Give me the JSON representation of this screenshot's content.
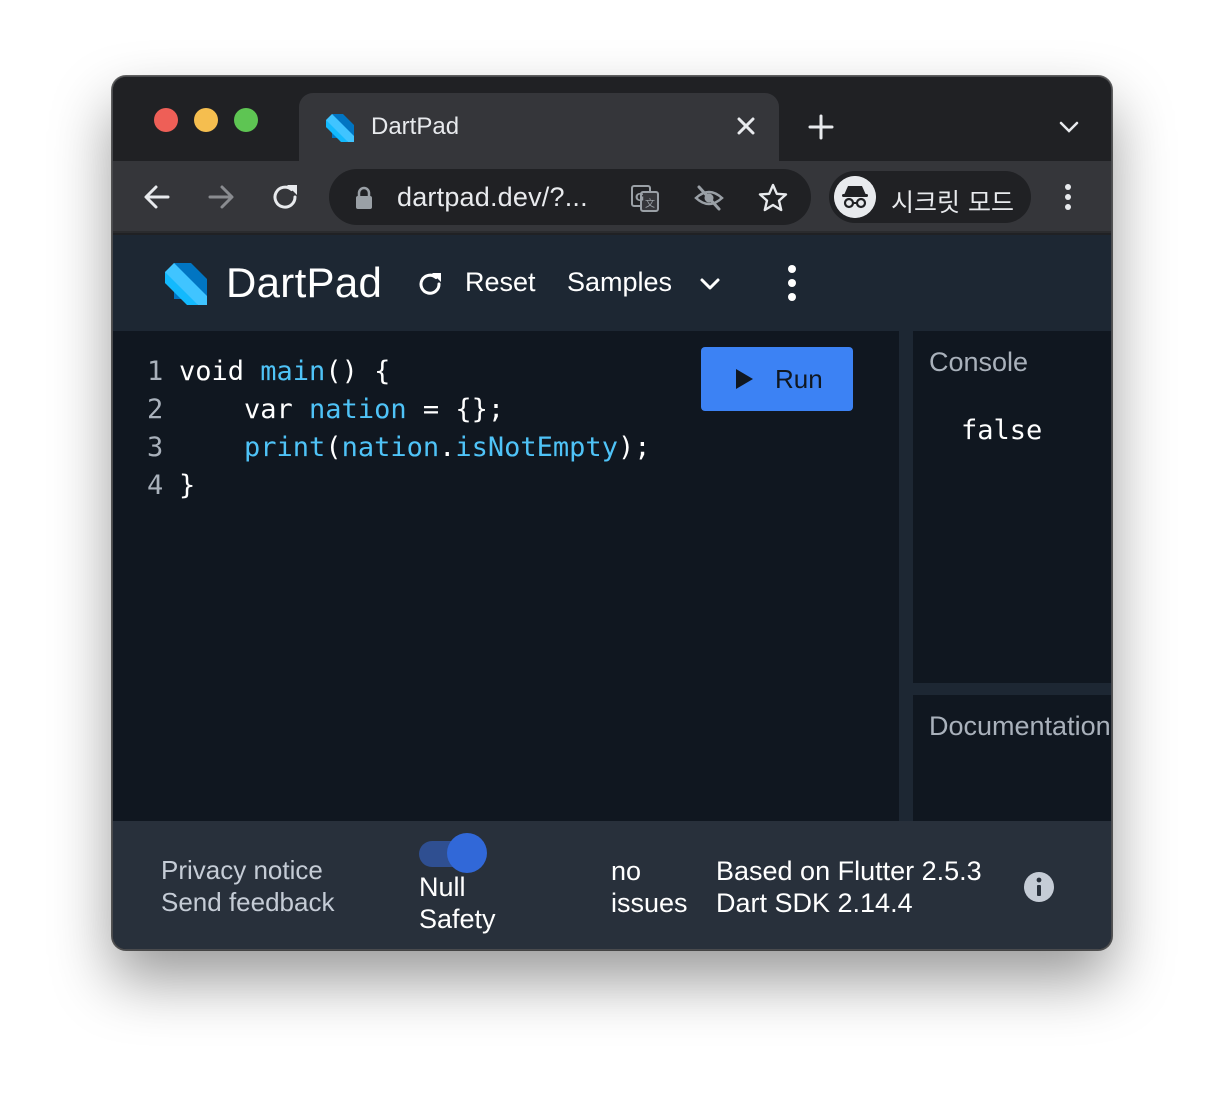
{
  "browser": {
    "tab": {
      "title": "DartPad",
      "favicon": "dart-logo-icon",
      "close_icon": "close-icon"
    },
    "new_tab_icon": "plus-icon",
    "tab_menu_icon": "chevron-down-icon",
    "nav": {
      "back_icon": "arrow-left-icon",
      "forward_icon": "arrow-right-icon",
      "reload_icon": "reload-icon"
    },
    "omnibox": {
      "url": "dartpad.dev/?...",
      "icons": [
        "lock-icon",
        "translate-icon",
        "eye-off-icon",
        "star-icon"
      ]
    },
    "incognito": {
      "label": "시크릿 모드",
      "icon": "incognito-icon"
    },
    "menu_icon": "kebab-icon"
  },
  "app": {
    "title": "DartPad",
    "logo": "dart-logo-icon",
    "reset_label": "Reset",
    "samples_label": "Samples",
    "menu_icon": "kebab-icon"
  },
  "editor": {
    "run_label": "Run",
    "lines": [
      {
        "n": "1",
        "parts": [
          {
            "t": "void ",
            "c": ""
          },
          {
            "t": "main",
            "c": "fn"
          },
          {
            "t": "() {",
            "c": ""
          }
        ]
      },
      {
        "n": "2",
        "parts": [
          {
            "t": "    var ",
            "c": ""
          },
          {
            "t": "nation",
            "c": "id"
          },
          {
            "t": " = {};",
            "c": ""
          }
        ]
      },
      {
        "n": "3",
        "parts": [
          {
            "t": "    ",
            "c": ""
          },
          {
            "t": "print",
            "c": "fn"
          },
          {
            "t": "(",
            "c": ""
          },
          {
            "t": "nation",
            "c": "id"
          },
          {
            "t": ".",
            "c": ""
          },
          {
            "t": "isNotEmpty",
            "c": "id"
          },
          {
            "t": ");",
            "c": ""
          }
        ]
      },
      {
        "n": "4",
        "parts": [
          {
            "t": "}",
            "c": ""
          }
        ]
      }
    ]
  },
  "console": {
    "title": "Console",
    "output": "false"
  },
  "documentation": {
    "title": "Documentation"
  },
  "footer": {
    "privacy": "Privacy notice",
    "feedback": "Send feedback",
    "null_safety": {
      "line1": "Null",
      "line2": "Safety",
      "enabled": true
    },
    "issues": {
      "line1": "no",
      "line2": "issues"
    },
    "flutter_version": "Based on Flutter 2.5.3",
    "sdk_version": "Dart SDK 2.14.4",
    "info_icon": "info-icon"
  },
  "colors": {
    "accent": "#3c82f4",
    "code_identifier": "#4fc3f7",
    "editor_bg": "#101720",
    "header_bg": "#1d2733",
    "footer_bg": "#28303b"
  }
}
